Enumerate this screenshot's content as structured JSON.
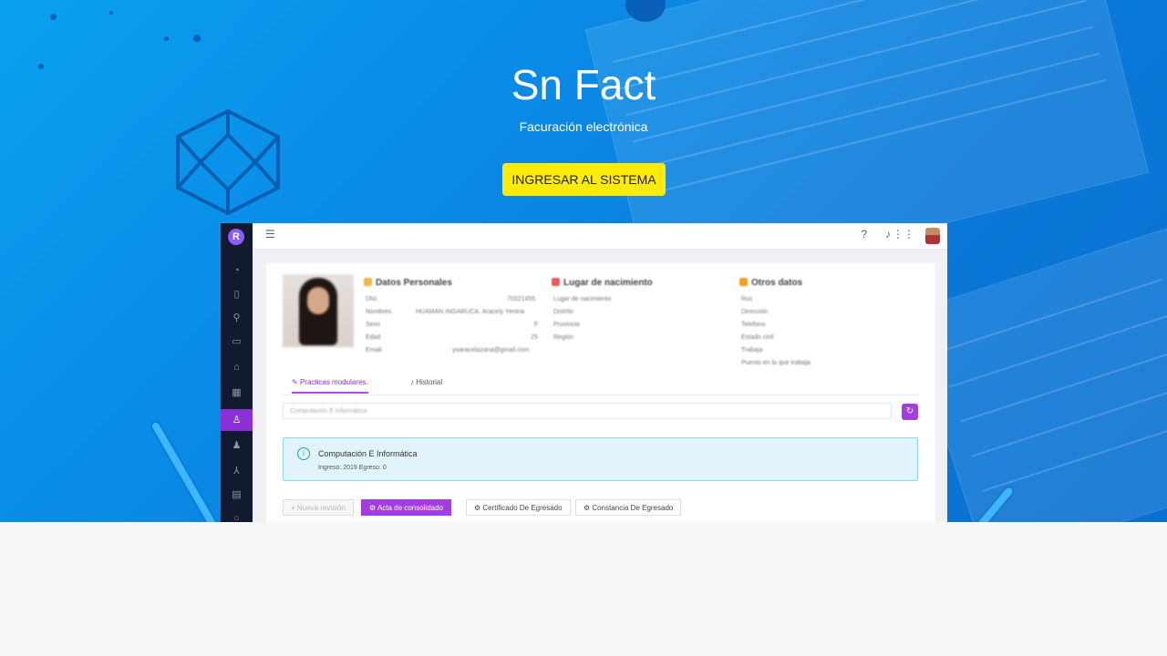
{
  "hero": {
    "title": "Sn Fact",
    "subtitle": "Facuración electrónica",
    "cta_label": "INGRESAR AL SISTEMA"
  },
  "colors": {
    "hero_blue": "#0a8be6",
    "cta_yellow": "#ffeb0a",
    "accent_purple": "#a23ee0",
    "sidebar_dark": "#111a2e"
  },
  "preview": {
    "logo": "R",
    "sidebar_icons": [
      "dashboard-icon",
      "document-icon",
      "search-icon",
      "folder-icon",
      "bank-icon",
      "building-icon",
      "user-icon",
      "users-icon",
      "network-icon",
      "report-icon",
      "circle-icon"
    ],
    "topbar_icons": [
      "help-icon",
      "bell-icon",
      "apps-grid-icon"
    ],
    "personal": {
      "header": "Datos Personales",
      "rows": [
        {
          "k": "DNI",
          "v": "70321455"
        },
        {
          "k": "Nombres",
          "v": "HUAMAN INGARUCA, Aracely Yenina"
        },
        {
          "k": "Sexo",
          "v": "F"
        },
        {
          "k": "Edad",
          "v": "25"
        },
        {
          "k": "Email",
          "v": "yoaracelazana@gmail.com"
        }
      ]
    },
    "birth": {
      "header": "Lugar de nacimiento",
      "rows": [
        "Lugar de nacimiento",
        "Distrito",
        "Provincia",
        "Región"
      ]
    },
    "other": {
      "header": "Otros datos",
      "rows": [
        "Ruc",
        "Dirección",
        "Telefono",
        "Estado civil",
        "Trabaja",
        "Puesto en la que trabaja"
      ]
    },
    "tabs": [
      "Practicas modulares.",
      "Historial"
    ],
    "select_value": "Computación E Informática",
    "alert": {
      "title": "Computación E Informática",
      "detail": "Ingreso: 2019 Egreso: 0"
    },
    "buttons": {
      "new_review": "Nueva revisión",
      "consolidated": "Acta de consolidado",
      "certificate": "Certificado De Egresado",
      "constancy": "Constancia De Egresado"
    }
  }
}
